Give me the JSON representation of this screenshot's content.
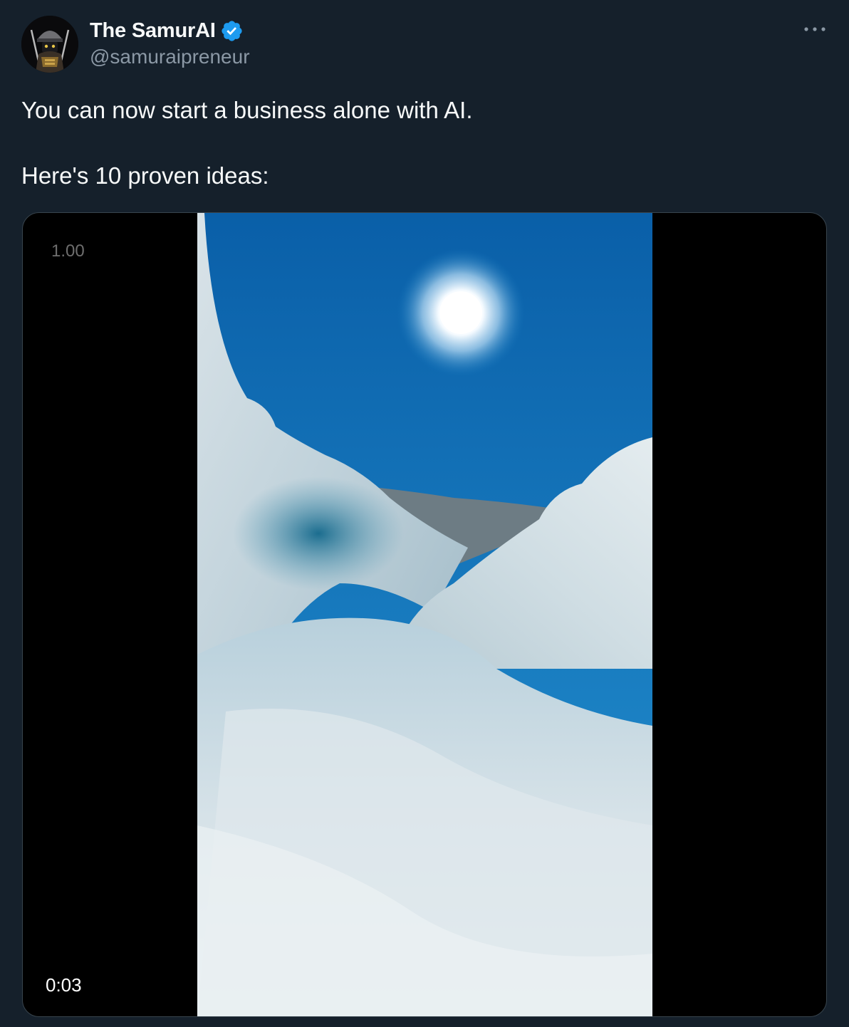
{
  "author": {
    "display_name": "The SamurAI",
    "handle": "@samuraipreneur",
    "verified": true,
    "verified_color": "#1d9bf0",
    "avatar_icon": "samurai-avatar-icon"
  },
  "actions": {
    "more_icon": "more-horizontal-icon"
  },
  "tweet": {
    "text": "You can now start a business alone with AI.\n\nHere's 10 proven ideas:"
  },
  "media": {
    "type": "video",
    "playback_speed": "1.00",
    "elapsed_time": "0:03",
    "scene": "ice-cave-sky-sun"
  },
  "colors": {
    "background": "#15202b",
    "text_primary": "#f7f9f9",
    "text_secondary": "#8b98a5",
    "border": "#38444d"
  }
}
